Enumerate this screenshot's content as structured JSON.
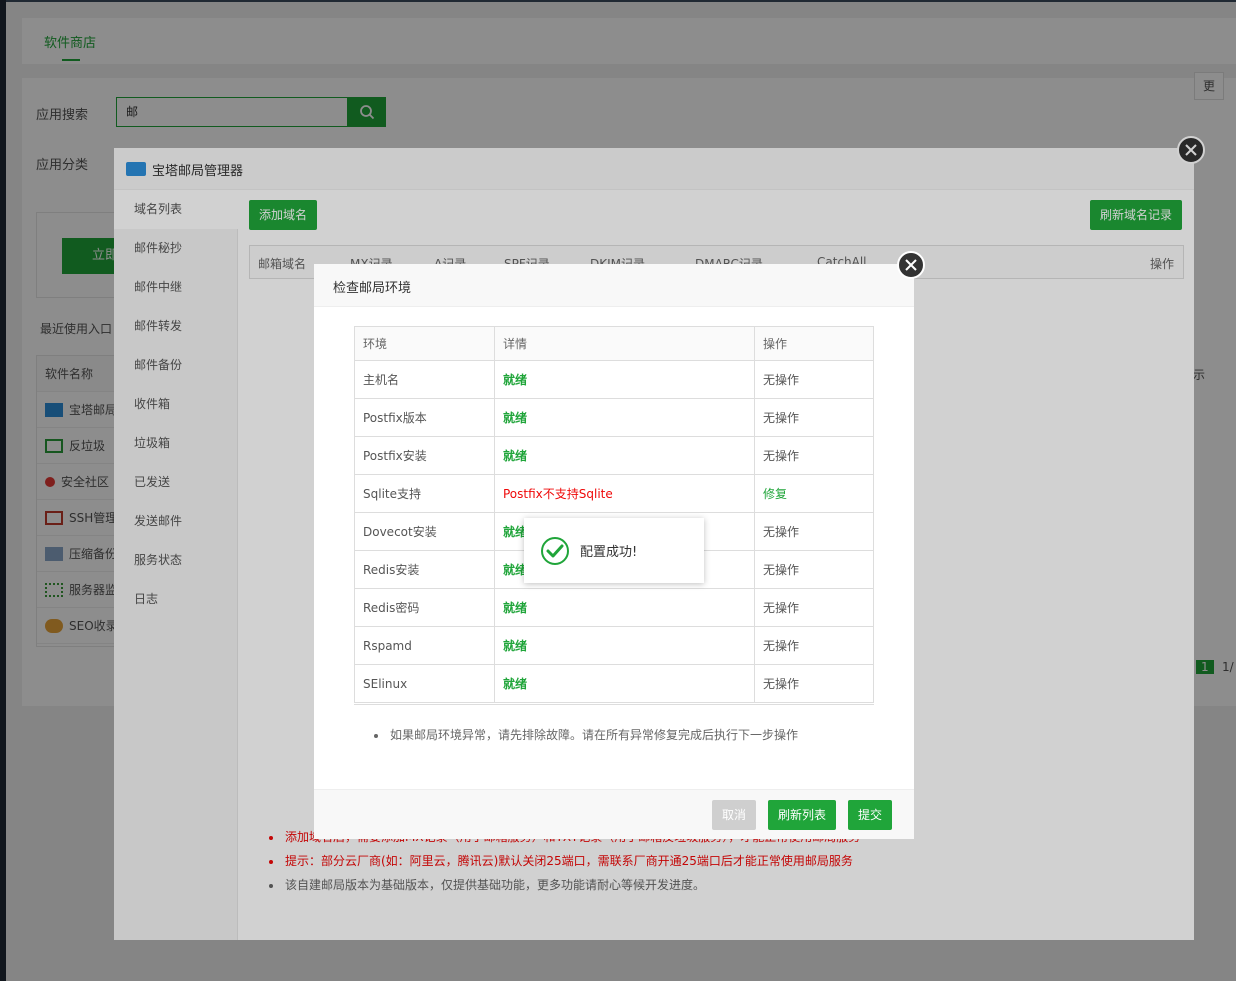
{
  "page": {
    "tab_label": "软件商店",
    "search_label": "应用搜索",
    "search_value": "邮",
    "category_label": "应用分类",
    "recent_label": "最近使用入口",
    "bg_button": "立即",
    "right_button": "更",
    "right_col": "示",
    "pager_current": "1",
    "pager_total": "1/",
    "software_header": "软件名称",
    "software_rows": [
      "宝塔邮局",
      "反垃圾",
      "安全社区",
      "SSH管理",
      "压缩备份",
      "服务器监",
      "SEO收录"
    ]
  },
  "mail_manager": {
    "title": "宝塔邮局管理器",
    "sidebar": [
      "域名列表",
      "邮件秘抄",
      "邮件中继",
      "邮件转发",
      "邮件备份",
      "收件箱",
      "垃圾箱",
      "已发送",
      "发送邮件",
      "服务状态",
      "日志"
    ],
    "add_domain": "添加域名",
    "refresh_records": "刷新域名记录",
    "columns": [
      "邮箱域名",
      "MX记录",
      "A记录",
      "SPF记录",
      "DKIM记录",
      "DMARC记录",
      "CatchAll",
      "",
      "操作"
    ],
    "tips": [
      "添加域名后，需要添加MX记录（用于邮箱服务）和TXT记录（用于邮箱反垃圾服务），才能正常使用邮局服务",
      "提示：部分云厂商(如：阿里云，腾讯云)默认关闭25端口，需联系厂商开通25端口后才能正常使用邮局服务",
      "该自建邮局版本为基础版本，仅提供基础功能，更多功能请耐心等候开发进度。"
    ]
  },
  "env_dialog": {
    "title": "检查邮局环境",
    "headers": [
      "环境",
      "详情",
      "操作"
    ],
    "rows": [
      {
        "env": "主机名",
        "detail": "就绪",
        "action": "无操作"
      },
      {
        "env": "Postfix版本",
        "detail": "就绪",
        "action": "无操作"
      },
      {
        "env": "Postfix安装",
        "detail": "就绪",
        "action": "无操作"
      },
      {
        "env": "Sqlite支持",
        "detail": "Postfix不支持Sqlite",
        "action": "修复"
      },
      {
        "env": "Dovecot安装",
        "detail": "就绪",
        "action": "无操作"
      },
      {
        "env": "Redis安装",
        "detail": "就绪",
        "action": "无操作"
      },
      {
        "env": "Redis密码",
        "detail": "就绪",
        "action": "无操作"
      },
      {
        "env": "Rspamd",
        "detail": "就绪",
        "action": "无操作"
      },
      {
        "env": "SElinux",
        "detail": "就绪",
        "action": "无操作"
      }
    ],
    "note": "如果邮局环境异常，请先排除故障。请在所有异常修复完成后执行下一步操作",
    "cancel": "取消",
    "refresh_list": "刷新列表",
    "submit": "提交"
  },
  "toast": {
    "message": "配置成功!"
  },
  "colors": {
    "green": "#20a53a",
    "red": "#ef0808"
  }
}
